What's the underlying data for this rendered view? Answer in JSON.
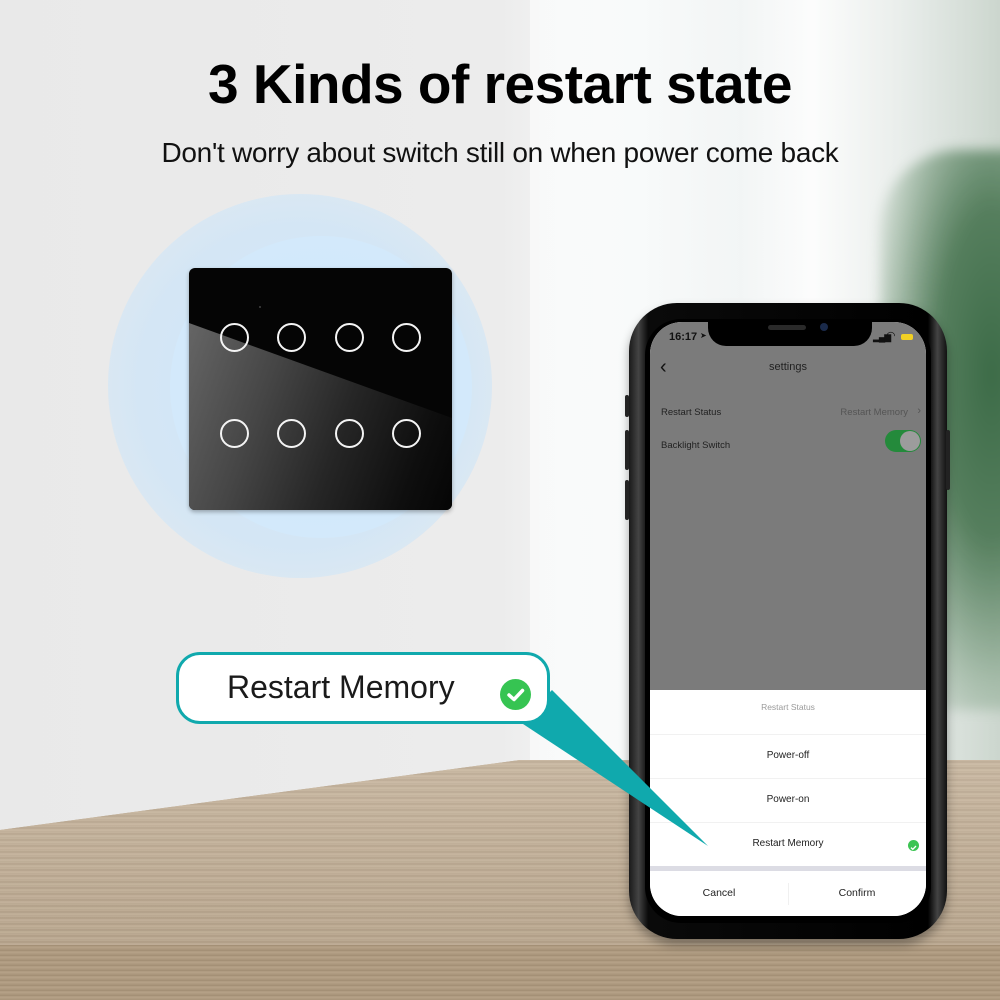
{
  "headline": "3 Kinds of restart state",
  "subheadline": "Don't worry about switch still on when power come back",
  "callout": {
    "label": "Restart Memory",
    "icon": "check-circle-icon",
    "border_color": "#10a9ad",
    "check_color": "#36c452"
  },
  "switch_panel": {
    "button_count": 8,
    "rows": 2,
    "columns": 4
  },
  "phone": {
    "status_bar": {
      "time": "16:17",
      "location_icon": "➤",
      "signal_icon": "signal-icon",
      "wifi_icon": "wifi-icon",
      "battery_icon": "battery-icon"
    },
    "nav": {
      "back_icon": "‹",
      "title": "settings"
    },
    "settings": [
      {
        "label": "Restart Status",
        "value": "Restart Memory",
        "chevron": "›"
      },
      {
        "label": "Backlight Switch",
        "toggle_on": true
      }
    ],
    "sheet": {
      "title": "Restart Status",
      "options": [
        {
          "label": "Power-off",
          "selected": false
        },
        {
          "label": "Power-on",
          "selected": false
        },
        {
          "label": "Restart Memory",
          "selected": true
        }
      ],
      "cancel_label": "Cancel",
      "confirm_label": "Confirm"
    },
    "colors": {
      "toggle_on": "#248a3b",
      "selected_check": "#3cc453",
      "battery": "#f1d024"
    }
  }
}
